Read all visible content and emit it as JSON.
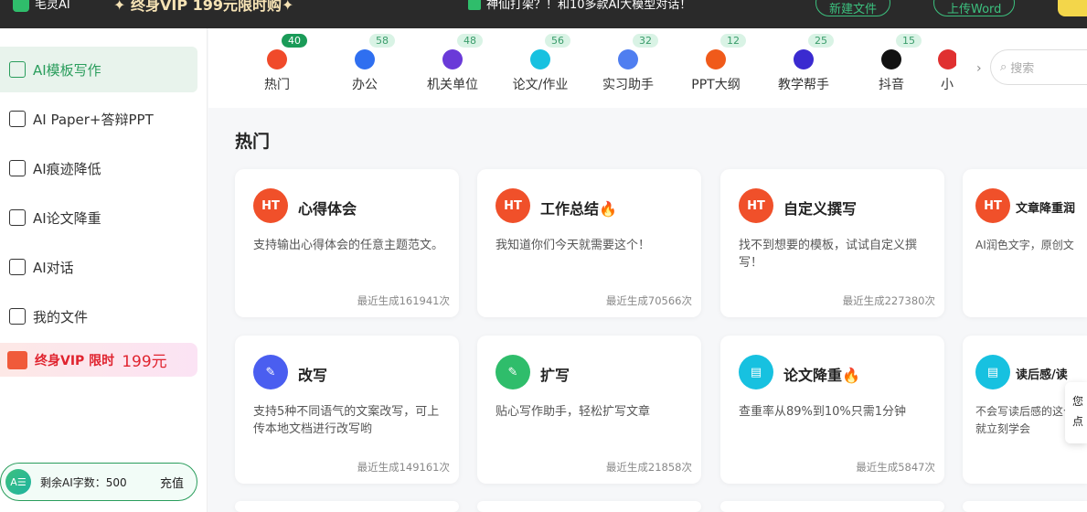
{
  "topbar": {
    "app_name": "毛灵AI",
    "promo": "✦ 终身VIP 199元限时购✦",
    "notice": "神仙打架？！和10多款AI大模型对话！",
    "new_file": "新建文件",
    "upload_word": "上传Word"
  },
  "sidebar": {
    "items": [
      {
        "label": "AI模板写作",
        "icon": "template-icon"
      },
      {
        "label": "AI Paper+答辩PPT",
        "icon": "paper-icon"
      },
      {
        "label": "AI痕迹降低",
        "icon": "reduce-icon"
      },
      {
        "label": "AI论文降重",
        "icon": "dedup-icon"
      },
      {
        "label": "AI对话",
        "icon": "chat-icon"
      },
      {
        "label": "我的文件",
        "icon": "file-icon"
      }
    ],
    "vip": {
      "label": "终身VIP 限时",
      "price": "199元"
    },
    "quota": {
      "avatar": "A☰",
      "label": "剩余AI字数：500",
      "recharge": "充值"
    }
  },
  "categories": [
    {
      "label": "热门",
      "count": "40",
      "color": "#f04a2a"
    },
    {
      "label": "办公",
      "count": "58",
      "color": "#2f6ff0"
    },
    {
      "label": "机关单位",
      "count": "48",
      "color": "#6a3ad8"
    },
    {
      "label": "论文/作业",
      "count": "56",
      "color": "#17c1e0"
    },
    {
      "label": "实习助手",
      "count": "32",
      "color": "#4f7ef0"
    },
    {
      "label": "PPT大纲",
      "count": "12",
      "color": "#f05a1a"
    },
    {
      "label": "教学帮手",
      "count": "25",
      "color": "#3a2ad0"
    },
    {
      "label": "抖音",
      "count": "15",
      "color": "#111111"
    },
    {
      "label": "小",
      "count": "",
      "color": "#e03030"
    }
  ],
  "search_placeholder": "搜索",
  "section_title": "热门",
  "cards": [
    {
      "title": "心得体会",
      "desc": "支持输出心得体会的任意主题范文。",
      "count": "最近生成161941次",
      "icon": "HT",
      "color": "#f0502a"
    },
    {
      "title": "工作总结🔥",
      "desc": "我知道你们今天就需要这个！",
      "count": "最近生成70566次",
      "icon": "HT",
      "color": "#f0502a"
    },
    {
      "title": "自定义撰写",
      "desc": "找不到想要的模板，试试自定义撰写！",
      "count": "最近生成227380次",
      "icon": "HT",
      "color": "#f0502a"
    },
    {
      "title": "文章降重润",
      "desc": "AI润色文字，原创文",
      "count": "",
      "icon": "HT",
      "color": "#f0502a"
    },
    {
      "title": "改写",
      "desc": "支持5种不同语气的文案改写，可上传本地文档进行改写哟",
      "count": "最近生成149161次",
      "icon": "✎",
      "color": "#4a5ef0"
    },
    {
      "title": "扩写",
      "desc": "贴心写作助手，轻松扩写文章",
      "count": "最近生成21858次",
      "icon": "✎",
      "color": "#2fbd6b"
    },
    {
      "title": "论文降重🔥",
      "desc": "查重率从89%到10%只需1分钟",
      "count": "最近生成5847次",
      "icon": "▤",
      "color": "#17c1e0"
    },
    {
      "title": "读后感/读",
      "desc": "不会写读后感的这个就立刻学会",
      "count": "",
      "icon": "▤",
      "color": "#17c1e0"
    }
  ],
  "tooltip": {
    "line1": "您",
    "line2": "点"
  }
}
